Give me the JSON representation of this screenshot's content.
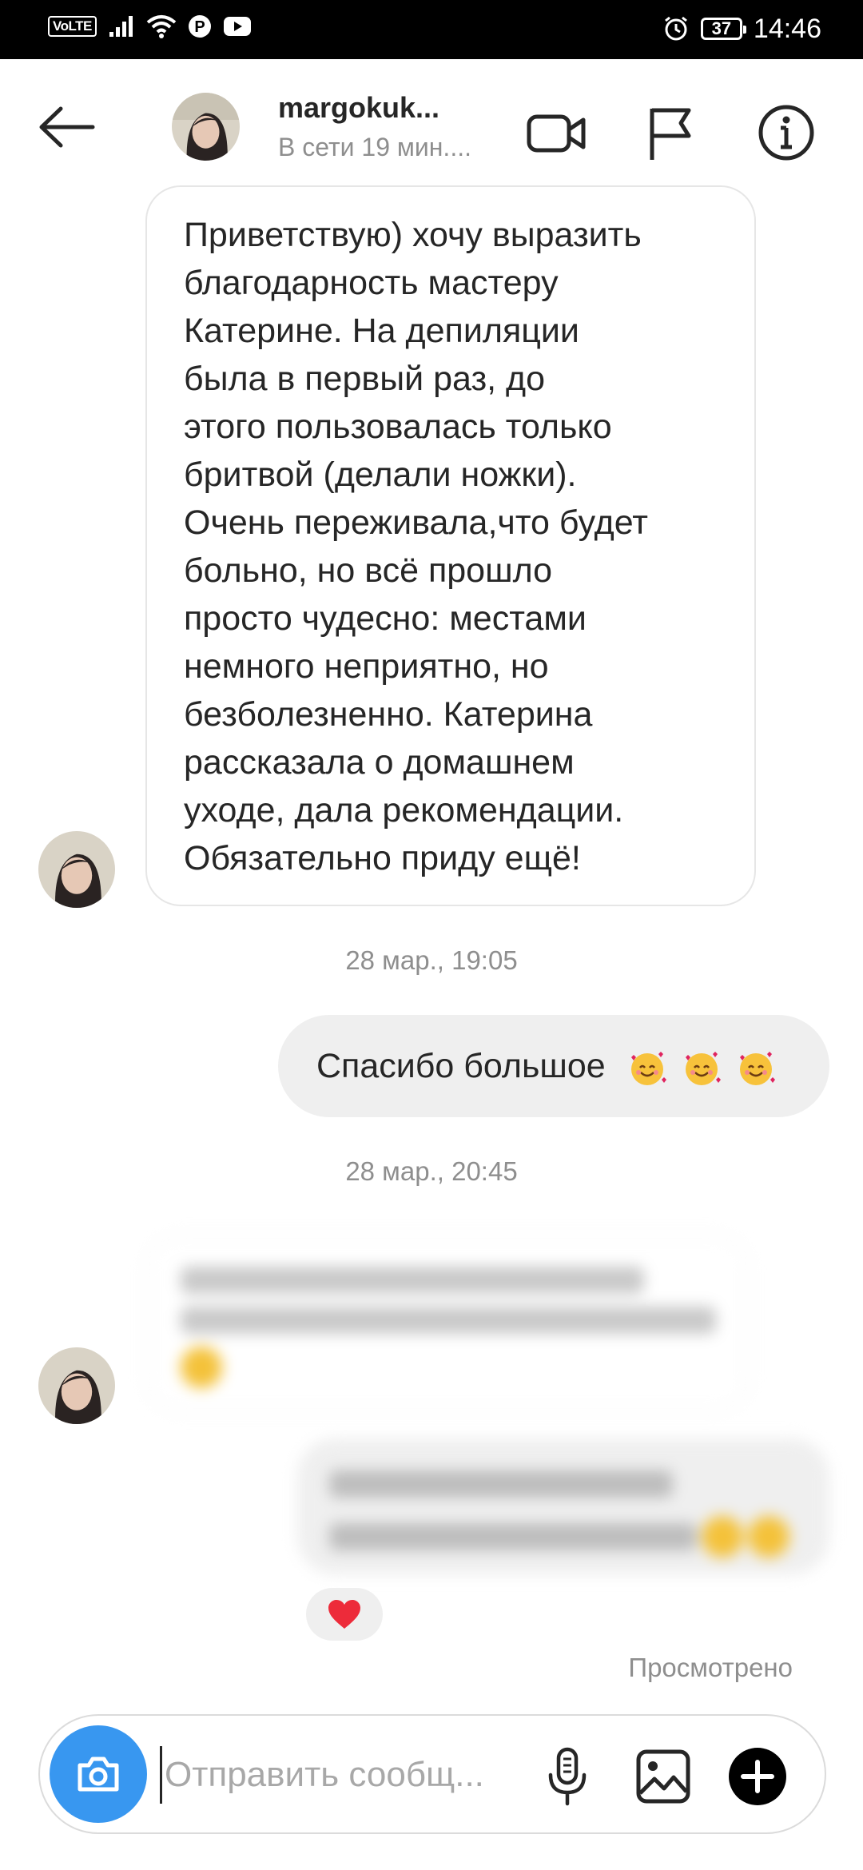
{
  "status_bar": {
    "time": "14:46",
    "battery": "37",
    "network": "VoLTE"
  },
  "header": {
    "username": "margokuk...",
    "status": "В сети 19 мин...."
  },
  "messages": [
    {
      "direction": "incoming",
      "text": "Приветствую) хочу выразить\nблагодарность мастеру\nКатерине. На депиляции\nбыла в первый раз, до\nэтого пользовалась  только\nбритвой (делали ножки).\nОчень переживала,что будет\nбольно, но всё прошло\nпросто чудесно: местами\nнемного неприятно, но\nбезболезненно. Катерина\nрассказала о домашнем\nуходе, дала рекомендации.\nОбязательно приду ещё!"
    },
    {
      "timestamp": "28 мар., 19:05"
    },
    {
      "direction": "outgoing",
      "text": "Спасибо большое",
      "emoji_count": 3
    },
    {
      "timestamp": "28 мар., 20:45"
    },
    {
      "direction": "incoming",
      "blurred": true
    },
    {
      "direction": "outgoing",
      "blurred": true,
      "reaction": "heart"
    }
  ],
  "seen_label": "Просмотрено",
  "composer": {
    "placeholder": "Отправить сообщ..."
  },
  "icons": {
    "back": "arrow-left-icon",
    "video": "video-camera-icon",
    "flag": "flag-icon",
    "info": "info-icon",
    "camera": "camera-icon",
    "mic": "microphone-icon",
    "gallery": "image-icon",
    "add": "plus-icon"
  },
  "colors": {
    "accent": "#3897f0",
    "outgoing_bubble": "#efefef",
    "muted": "#8e8e8e",
    "heart": "#ed2b3a"
  }
}
